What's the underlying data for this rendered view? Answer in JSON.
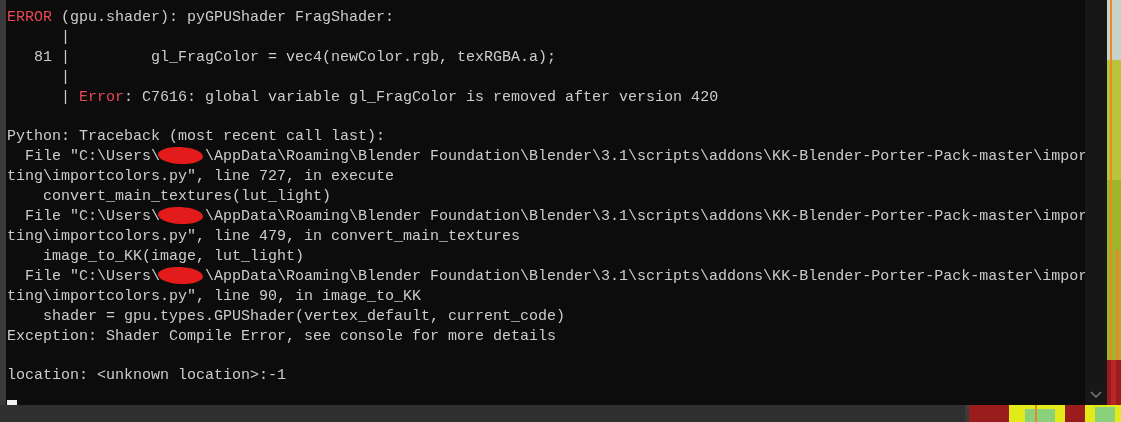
{
  "console": {
    "lines": [
      {
        "kind": "label",
        "label": "ERROR",
        "text": " (gpu.shader): pyGPUShader FragShader:"
      },
      {
        "kind": "plain",
        "text": "      |"
      },
      {
        "kind": "plain",
        "text": "   81 |         gl_FragColor = vec4(newColor.rgb, texRGBA.a);"
      },
      {
        "kind": "plain",
        "text": "      |"
      },
      {
        "kind": "label",
        "prefix": "      | ",
        "label": "Error",
        "text": ": C7616: global variable gl_FragColor is removed after version 420"
      },
      {
        "kind": "blank"
      },
      {
        "kind": "plain",
        "text": "Python: Traceback (most recent call last):"
      },
      {
        "kind": "frame",
        "before": "  File \"C:\\Users\\",
        "after": "\\AppData\\Roaming\\Blender Foundation\\Blender\\3.1\\scripts\\addons\\KK-Blender-Porter-Pack-master\\impor",
        "redacted": true
      },
      {
        "kind": "plain",
        "text": "ting\\importcolors.py\", line 727, in execute"
      },
      {
        "kind": "plain",
        "text": "    convert_main_textures(lut_light)"
      },
      {
        "kind": "frame",
        "before": "  File \"C:\\Users\\",
        "after": "\\AppData\\Roaming\\Blender Foundation\\Blender\\3.1\\scripts\\addons\\KK-Blender-Porter-Pack-master\\impor",
        "redacted": true
      },
      {
        "kind": "plain",
        "text": "ting\\importcolors.py\", line 479, in convert_main_textures"
      },
      {
        "kind": "plain",
        "text": "    image_to_KK(image, lut_light)"
      },
      {
        "kind": "frame",
        "before": "  File \"C:\\Users\\",
        "after": "\\AppData\\Roaming\\Blender Foundation\\Blender\\3.1\\scripts\\addons\\KK-Blender-Porter-Pack-master\\impor",
        "redacted": true
      },
      {
        "kind": "plain",
        "text": "ting\\importcolors.py\", line 90, in image_to_KK"
      },
      {
        "kind": "plain",
        "text": "    shader = gpu.types.GPUShader(vertex_default, current_code)"
      },
      {
        "kind": "plain",
        "text": "Exception: Shader Compile Error, see console for more details"
      },
      {
        "kind": "blank"
      },
      {
        "kind": "plain",
        "text": "location: <unknown location>:-1"
      }
    ]
  }
}
